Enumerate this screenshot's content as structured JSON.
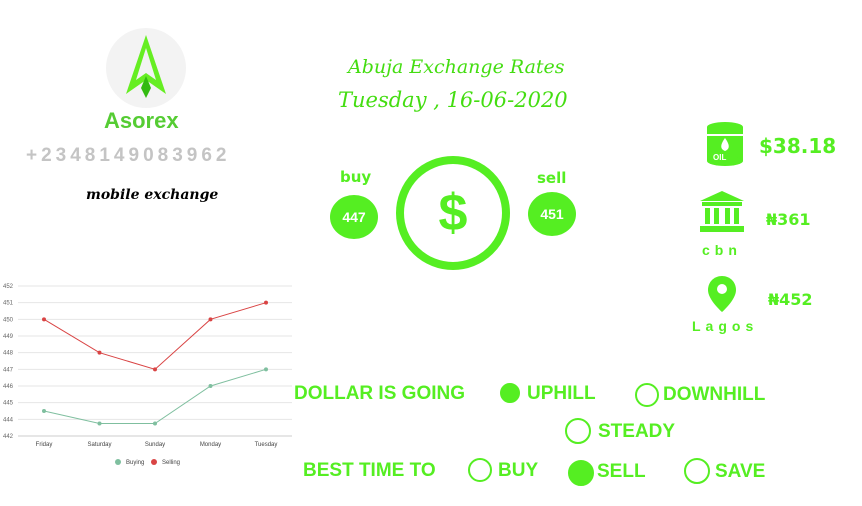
{
  "brand": {
    "name": "Asorex",
    "phone": "+2348149083962",
    "tagline": "mobile exchange"
  },
  "header": {
    "title": "Abuja Exchange Rates",
    "date": "Tuesday , 16-06-2020"
  },
  "rates": {
    "buy_label": "buy",
    "buy_value": "447",
    "sell_label": "sell",
    "sell_value": "451",
    "center_icon": "dollar-icon"
  },
  "indicators": {
    "oil": {
      "icon": "oil-barrel-icon",
      "icon_text": "OIL",
      "value": "$38.18"
    },
    "cbn": {
      "icon": "bank-icon",
      "label": "cbn",
      "value": "₦361"
    },
    "lagos": {
      "icon": "location-pin-icon",
      "label": "Lagos",
      "value": "₦452"
    }
  },
  "trend": {
    "question": "DOLLAR IS GOING",
    "options": [
      {
        "label": "UPHILL",
        "selected": true
      },
      {
        "label": "DOWNHILL",
        "selected": false
      },
      {
        "label": "STEADY",
        "selected": false
      }
    ]
  },
  "advice": {
    "question": "BEST TIME TO",
    "options": [
      {
        "label": "BUY",
        "selected": false
      },
      {
        "label": "SELL",
        "selected": true
      },
      {
        "label": "SAVE",
        "selected": false
      }
    ]
  },
  "colors": {
    "accent": "#55ee22",
    "buying": "#7fbf9f",
    "selling": "#d94444"
  },
  "chart_data": {
    "type": "line",
    "categories": [
      "Friday",
      "Saturday",
      "Sunday",
      "Monday",
      "Tuesday"
    ],
    "yticks": [
      442,
      444,
      445,
      446,
      447,
      448,
      449,
      450,
      451,
      452
    ],
    "ylim": [
      442,
      452
    ],
    "series": [
      {
        "name": "Buying",
        "values": [
          444.5,
          443.5,
          443.5,
          446,
          447
        ]
      },
      {
        "name": "Selling",
        "values": [
          450,
          448,
          447,
          450,
          451
        ]
      }
    ],
    "legend": "bottom",
    "grid": true
  }
}
